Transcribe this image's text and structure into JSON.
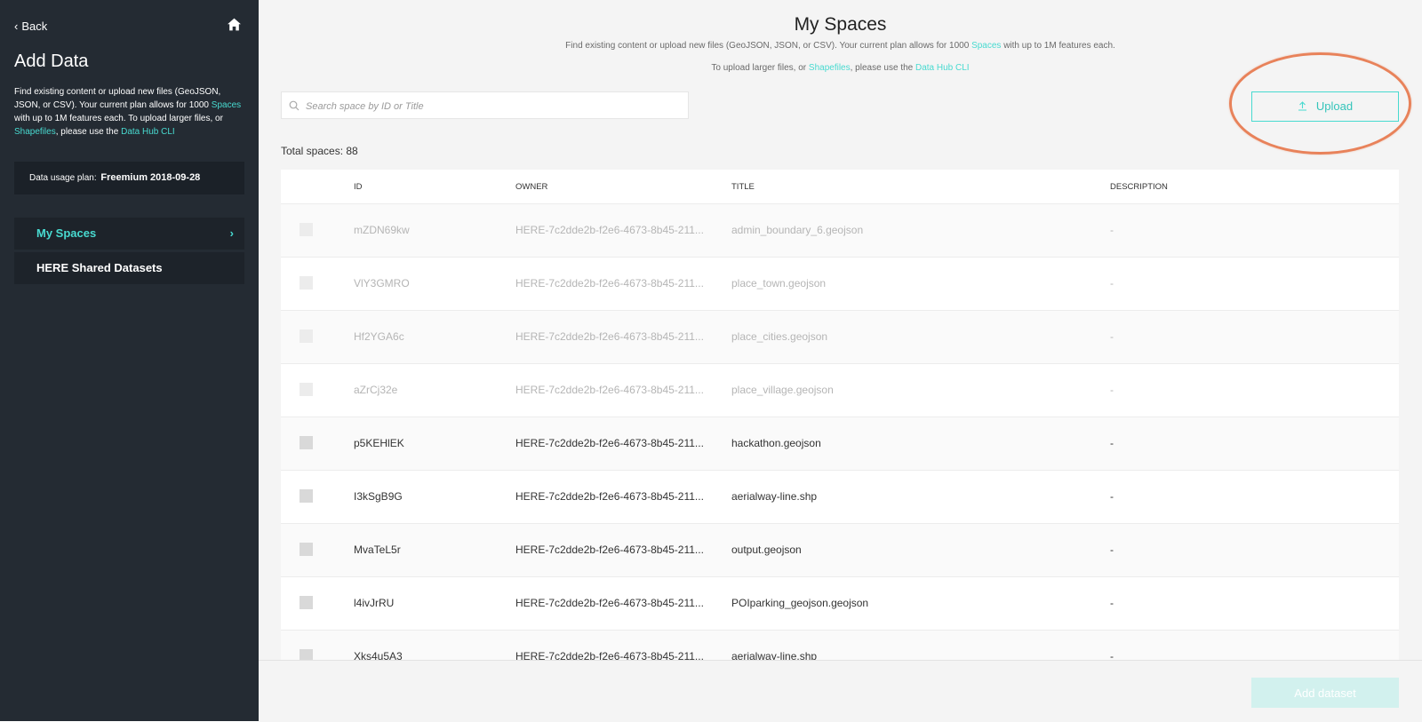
{
  "sidebar": {
    "back_label": "Back",
    "title": "Add Data",
    "desc": {
      "part1": "Find existing content or upload new files (GeoJSON, JSON, or CSV). Your current plan allows for 1000 ",
      "spaces_link": "Spaces",
      "part2": " with up to 1M features each. To upload larger files, or ",
      "shapefiles_link": "Shapefiles",
      "part3": ", please use the ",
      "cli_link": "Data Hub CLI"
    },
    "plan_label": "Data usage plan:",
    "plan_value": "Freemium 2018-09-28",
    "nav": [
      {
        "label": "My Spaces",
        "active": true
      },
      {
        "label": "HERE Shared Datasets",
        "active": false
      }
    ]
  },
  "main": {
    "title": "My Spaces",
    "sub1": {
      "text": "Find existing content or upload new files (GeoJSON, JSON, or CSV). Your current plan allows for 1000 ",
      "link": "Spaces",
      "text2": " with up to 1M features each."
    },
    "sub2": {
      "text": "To upload larger files, or ",
      "link1": "Shapefiles",
      "text2": ", please use the ",
      "link2": "Data Hub CLI"
    },
    "search_placeholder": "Search space by ID or Title",
    "upload_label": "Upload",
    "total_label": "Total spaces: 88",
    "columns": [
      "ID",
      "OWNER",
      "TITLE",
      "DESCRIPTION"
    ],
    "rows": [
      {
        "id": "mZDN69kw",
        "owner": "HERE-7c2dde2b-f2e6-4673-8b45-211...",
        "title": "admin_boundary_6.geojson",
        "desc": "-",
        "dim": true
      },
      {
        "id": "VlY3GMRO",
        "owner": "HERE-7c2dde2b-f2e6-4673-8b45-211...",
        "title": "place_town.geojson",
        "desc": "-",
        "dim": true
      },
      {
        "id": "Hf2YGA6c",
        "owner": "HERE-7c2dde2b-f2e6-4673-8b45-211...",
        "title": "place_cities.geojson",
        "desc": "-",
        "dim": true
      },
      {
        "id": "aZrCj32e",
        "owner": "HERE-7c2dde2b-f2e6-4673-8b45-211...",
        "title": "place_village.geojson",
        "desc": "-",
        "dim": true
      },
      {
        "id": "p5KEHlEK",
        "owner": "HERE-7c2dde2b-f2e6-4673-8b45-211...",
        "title": "hackathon.geojson",
        "desc": "-",
        "dim": false
      },
      {
        "id": "I3kSgB9G",
        "owner": "HERE-7c2dde2b-f2e6-4673-8b45-211...",
        "title": "aerialway-line.shp",
        "desc": "-",
        "dim": false
      },
      {
        "id": "MvaTeL5r",
        "owner": "HERE-7c2dde2b-f2e6-4673-8b45-211...",
        "title": "output.geojson",
        "desc": "-",
        "dim": false
      },
      {
        "id": "l4ivJrRU",
        "owner": "HERE-7c2dde2b-f2e6-4673-8b45-211...",
        "title": "POIparking_geojson.geojson",
        "desc": "-",
        "dim": false
      },
      {
        "id": "Xks4u5A3",
        "owner": "HERE-7c2dde2b-f2e6-4673-8b45-211...",
        "title": "aerialway-line.shp",
        "desc": "-",
        "dim": false
      }
    ],
    "add_dataset_label": "Add dataset"
  },
  "colors": {
    "accent": "#48dad0",
    "sidebar_bg": "#242b33",
    "highlight": "#e8825a"
  }
}
